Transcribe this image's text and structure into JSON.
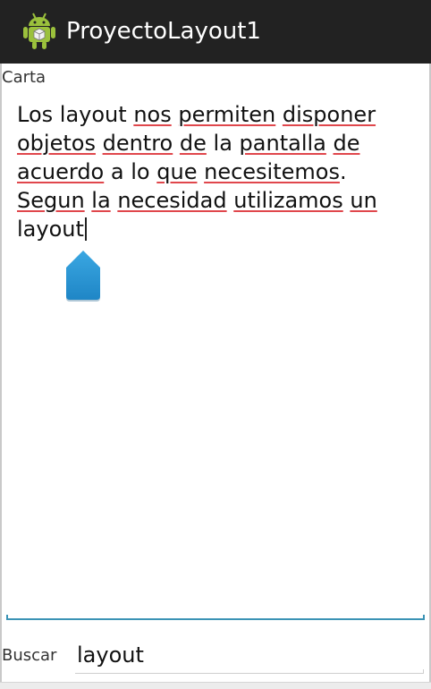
{
  "action_bar": {
    "title": "ProyectoLayout1",
    "background": "#222222",
    "icon": "android-robot-icon"
  },
  "form": {
    "letter_label": "Carta",
    "letter_text_words": [
      {
        "text": "Los",
        "misspelled": false
      },
      {
        "text": "layout",
        "misspelled": false
      },
      {
        "text": "nos",
        "misspelled": true
      },
      {
        "text": "permiten",
        "misspelled": true
      },
      {
        "text": "disponer",
        "misspelled": true
      },
      {
        "text": "objetos",
        "misspelled": true
      },
      {
        "text": "dentro",
        "misspelled": true
      },
      {
        "text": "de",
        "misspelled": true
      },
      {
        "text": "la",
        "misspelled": false
      },
      {
        "text": "pantalla",
        "misspelled": true
      },
      {
        "text": "de",
        "misspelled": true
      },
      {
        "text": "acuerdo",
        "misspelled": true
      },
      {
        "text": "a",
        "misspelled": false
      },
      {
        "text": "lo",
        "misspelled": false
      },
      {
        "text": "que",
        "misspelled": true
      },
      {
        "text": "necesitemos",
        "misspelled": true
      },
      {
        "text": ".",
        "misspelled": false,
        "attach": true
      },
      {
        "text": "Segun",
        "misspelled": true
      },
      {
        "text": "la",
        "misspelled": true
      },
      {
        "text": "necesidad",
        "misspelled": true
      },
      {
        "text": "utilizamos",
        "misspelled": true
      },
      {
        "text": "un",
        "misspelled": true
      },
      {
        "text": "layout",
        "misspelled": false
      }
    ],
    "search_label": "Buscar",
    "search_value": "layout",
    "accent_color": "#3a93b5",
    "spellcheck_color": "#e0474c",
    "handle_color": "#2c9bd8",
    "handle_icon": "text-selection-handle-icon"
  }
}
